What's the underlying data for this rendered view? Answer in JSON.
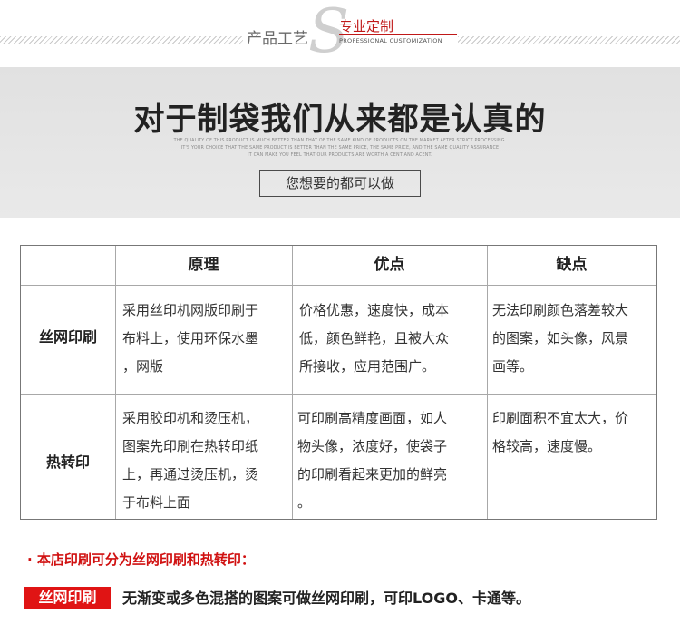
{
  "header": {
    "left_text": "产品工艺",
    "right_cn": "专业定制",
    "right_en": "PROFESSIONAL CUSTOMIZATION"
  },
  "banner": {
    "title": "对于制袋我们从来都是认真的",
    "sub_lines": [
      "THE QUALITY OF THIS PRODUCT IS MUCH BETTER THAN THAT OF THE SAME KIND OF PRODUCTS ON THE MARKET AFTER STRICT PROCESSING.",
      "IT'S YOUR CHOICE THAT THE SAME PRODUCT IS BETTER THAN THE SAME PRICE, THE SAME PRICE, AND THE SAME QUALITY ASSURANCE",
      "IT CAN MAKE YOU FEEL THAT OUR PRODUCTS ARE WORTH A CENT AND ACENT."
    ],
    "button_label": "您想要的都可以做"
  },
  "table": {
    "headers": [
      "原理",
      "优点",
      "缺点"
    ],
    "rows": [
      {
        "label": "丝网印刷",
        "principle": [
          "采用丝印机网版印刷于",
          "布料上，使用环保水墨",
          "，网版"
        ],
        "pros": [
          "价格优惠，速度快，成本",
          "低，颜色鲜艳，且被大众",
          "所接收，应用范围广。"
        ],
        "cons": [
          "无法印刷颜色落差较大",
          "的图案，如头像，风景",
          "画等。"
        ]
      },
      {
        "label": "热转印",
        "principle": [
          "采用胶印机和烫压机，",
          "图案先印刷在热转印纸",
          "上，再通过烫压机，烫",
          "于布料上面"
        ],
        "pros": [
          "可印刷高精度画面，如人",
          "物头像，浓度好，使袋子",
          "的印刷看起来更加的鲜亮",
          "。"
        ],
        "cons": [
          "印刷面积不宜太大，价",
          "格较高，速度慢。"
        ]
      }
    ]
  },
  "notes": {
    "red_note": "· 本店印刷可分为丝网印刷和热转印：",
    "tag_label": "丝网印刷",
    "tag_desc": "无渐变或多色混搭的图案可做丝网印刷，可印LOGO、卡通等。"
  }
}
